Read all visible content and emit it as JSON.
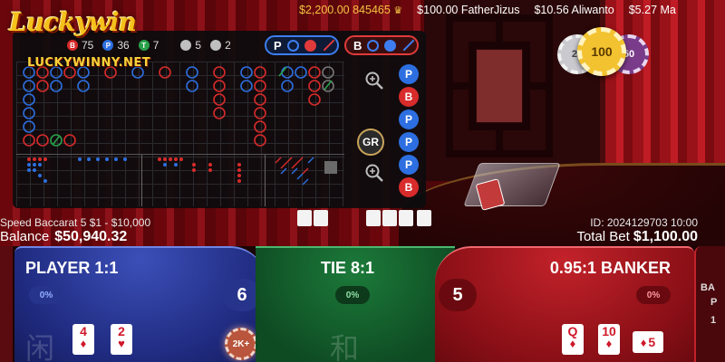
{
  "brand": {
    "logo_text": "Luckywin",
    "logo_url_text": "LUCKYWINNY.NET"
  },
  "top_strip": [
    {
      "amount": "$2,200.00",
      "name": "845465",
      "crowned": true
    },
    {
      "amount": "$100.00",
      "name": "FatherJizus",
      "crowned": false
    },
    {
      "amount": "$10.56",
      "name": "Aliwanto",
      "crowned": false
    },
    {
      "amount": "$5.27",
      "name": "Ma",
      "crowned": false
    }
  ],
  "table_chips": {
    "left": "25",
    "center": "100",
    "right": "50"
  },
  "roadmap": {
    "stats": [
      {
        "key": "banker",
        "label": "75",
        "color": "#d82b2b",
        "glyph": "B"
      },
      {
        "key": "player",
        "label": "36",
        "color": "#2d6fe0",
        "glyph": "P"
      },
      {
        "key": "tie",
        "label": "7",
        "color": "#28a04a",
        "glyph": "T"
      },
      {
        "key": "player-pair",
        "label": "5",
        "color": "#bfbfbf",
        "glyph": ""
      },
      {
        "key": "banker-pair",
        "label": "2",
        "color": "#bfbfbf",
        "glyph": ""
      }
    ],
    "predict_player_label": "P",
    "predict_banker_label": "B",
    "gr_label": "GR",
    "bead_column": [
      "P",
      "B",
      "P",
      "P",
      "P",
      "B"
    ]
  },
  "info": {
    "table_name": "Speed Baccarat 5 $1 - $10,000",
    "balance_label": "Balance",
    "balance_value": "$50,940.32",
    "round_id": "ID: 2024129703 10:00",
    "total_bet_label": "Total Bet",
    "total_bet_value": "$1,100.00"
  },
  "bets": {
    "player": {
      "label": "PLAYER",
      "odds": "1:1",
      "percent": "0%",
      "score": "6",
      "hanzi": "闲",
      "cards": [
        {
          "rank": "4",
          "suit": "♦"
        },
        {
          "rank": "2",
          "suit": "♥"
        }
      ],
      "chip": "2K+"
    },
    "tie": {
      "label": "TIE",
      "odds": "8:1",
      "percent": "0%",
      "hanzi": "和"
    },
    "banker": {
      "odds": "0.95:1",
      "label": "BANKER",
      "percent": "0%",
      "score": "5",
      "cards": [
        {
          "rank": "Q",
          "suit": "♦"
        },
        {
          "rank": "10",
          "suit": "♦"
        },
        {
          "rank": "5",
          "suit": "♦"
        }
      ]
    },
    "extra": {
      "line1": "BA",
      "line2": "P",
      "line3": "1"
    }
  },
  "colors": {
    "player": "#2d6fe0",
    "banker": "#d82b2b",
    "tie": "#28a04a",
    "gold": "#f6c343"
  }
}
